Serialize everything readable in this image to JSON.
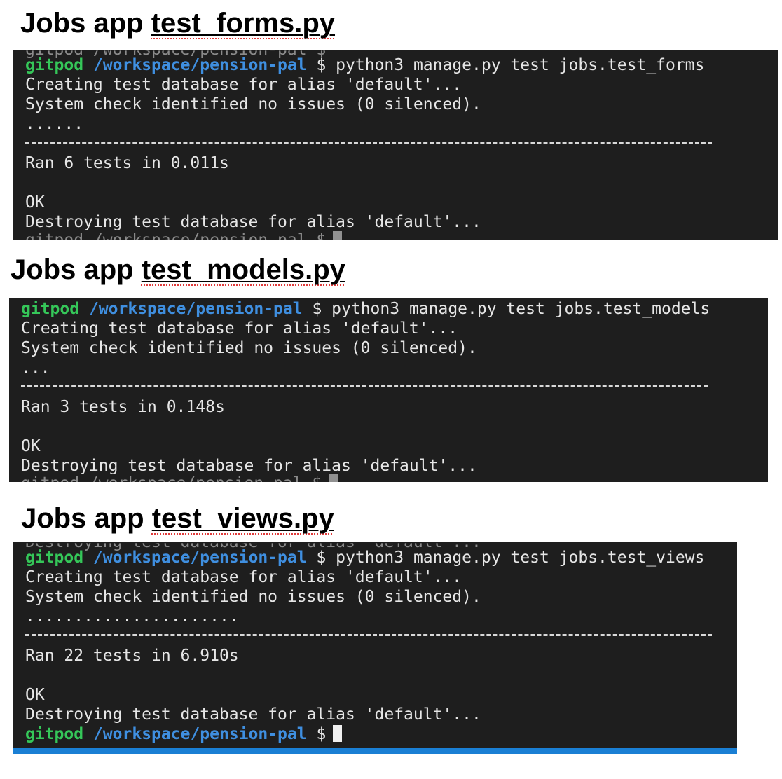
{
  "sections": [
    {
      "heading_prefix": "Jobs app ",
      "heading_file": "test_forms.py",
      "ghost_top": "gitpod /workspace/pension-pal $",
      "prompt_user": "gitpod",
      "prompt_path": "/workspace/pension-pal",
      "prompt_symbol": "$",
      "command": "python3 manage.py test jobs.test_forms",
      "creating": "Creating test database for alias 'default'...",
      "system_check": "System check identified no issues (0 silenced).",
      "progress_dots": "......",
      "ran": "Ran 6 tests in 0.011s",
      "result": "OK",
      "destroying": "Destroying test database for alias 'default'...",
      "ghost_bottom": "gitpod /workspace/pension-pal $"
    },
    {
      "heading_prefix": "Jobs app ",
      "heading_file": "test_models.py",
      "prompt_user": "gitpod",
      "prompt_path": "/workspace/pension-pal",
      "prompt_symbol": "$",
      "command": "python3 manage.py test jobs.test_models",
      "creating": "Creating test database for alias 'default'...",
      "system_check": "System check identified no issues (0 silenced).",
      "progress_dots": "...",
      "ran": "Ran 3 tests in 0.148s",
      "result": "OK",
      "destroying": "Destroying test database for alias 'default'...",
      "ghost_bottom": "gitpod /workspace/pension-pal $"
    },
    {
      "heading_prefix": "Jobs app ",
      "heading_file": "test_views.py",
      "ghost_top": "Destroying test database for alias 'default'...",
      "prompt_user": "gitpod",
      "prompt_path": "/workspace/pension-pal",
      "prompt_symbol": "$",
      "command": "python3 manage.py test jobs.test_views",
      "creating": "Creating test database for alias 'default'...",
      "system_check": "System check identified no issues (0 silenced).",
      "progress_dots": "......................",
      "ran": "Ran 22 tests in 6.910s",
      "result": "OK",
      "destroying": "Destroying test database for alias 'default'...",
      "final_prompt_user": "gitpod",
      "final_prompt_path": "/workspace/pension-pal",
      "final_prompt_symbol": "$"
    }
  ],
  "colors": {
    "terminal_background": "#1e1e1e",
    "terminal_text": "#e6e6e6",
    "prompt_user": "#35c759",
    "prompt_path": "#3f8fe0",
    "status_bar": "#1a7fd4",
    "spellcheck_underline": "#e03a3a"
  }
}
